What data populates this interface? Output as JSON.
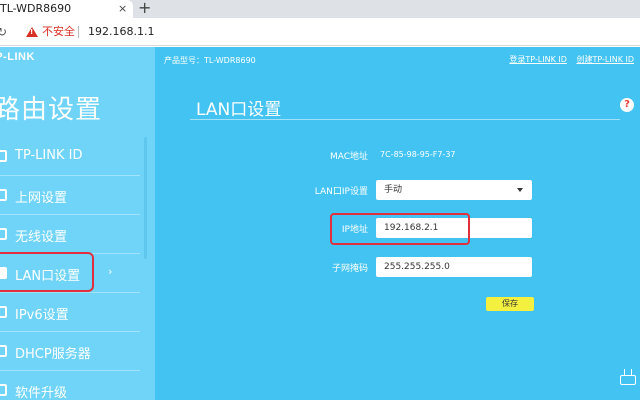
{
  "browser": {
    "tab_title": "TL-WDR8690",
    "close_glyph": "×",
    "new_tab_glyph": "+",
    "insecure_label": "不安全",
    "url": "192.168.1.1"
  },
  "router": {
    "logo": "TP-LINK",
    "sidebar_title": "路由设置",
    "model_line": "产品型号：TL-WDR8690",
    "header_links": [
      "登录TP-LINK ID",
      "创建TP-LINK ID"
    ],
    "nav_items": [
      {
        "label": "TP-LINK ID",
        "icon": "id-icon"
      },
      {
        "label": "上网设置",
        "icon": "globe-icon"
      },
      {
        "label": "无线设置",
        "icon": "wifi-icon"
      },
      {
        "label": "LAN口设置",
        "icon": "lan-icon",
        "active": true
      },
      {
        "label": "IPv6设置",
        "icon": "ipv6-icon"
      },
      {
        "label": "DHCP服务器",
        "icon": "dhcp-icon"
      },
      {
        "label": "软件升级",
        "icon": "upgrade-icon"
      }
    ],
    "active_arrow": "›"
  },
  "lan": {
    "section_title": "LAN口设置",
    "help_glyph": "?",
    "mac_label": "MAC地址",
    "mac_value": "7C-85-98-95-F7-37",
    "lan_ip_mode_label": "LAN口IP设置",
    "lan_ip_mode_value": "手动",
    "ip_label": "IP地址",
    "ip_value": "192.168.2.1",
    "subnet_label": "子网掩码",
    "subnet_value": "255.255.255.0",
    "save_label": "保存"
  },
  "colors": {
    "page_bg": "#42c3f2",
    "sidebar_bg": "#6fd4f8",
    "highlight": "#e0303e",
    "save_button": "#f4f040"
  }
}
